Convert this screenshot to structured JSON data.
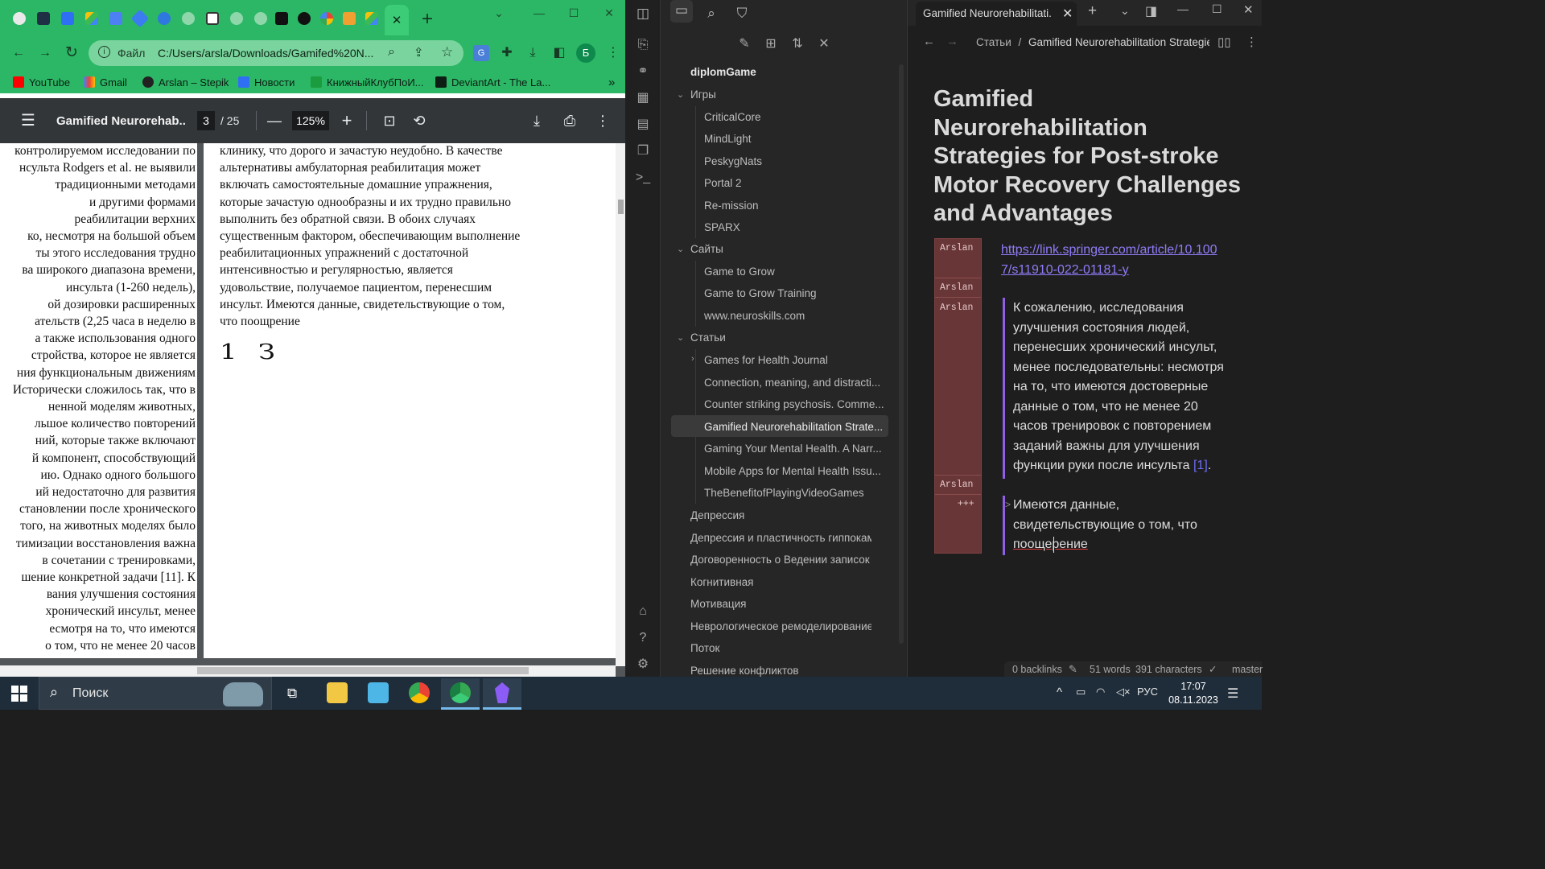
{
  "chrome": {
    "url_prefix": "Файл",
    "url": "C:/Users/arsla/Downloads/Gamifed%20N...",
    "profile_initial": "Б",
    "bookmarks": [
      "YouTube",
      "Gmail",
      "Arslan – Stepik",
      "Новости",
      "КнижныйКлубПоИ...",
      "DeviantArt - The La..."
    ],
    "bookmarks_more": "»",
    "tab_close": "✕",
    "new_tab": "+"
  },
  "pdf": {
    "title": "Gamified Neurorehab...",
    "page_current": "3",
    "page_total": "/ 25",
    "zoom": "125%",
    "left_column": [
      "контролируемом исследовании по",
      "нсульта Rodgers et al. не выявили",
      "традиционными    методами",
      "и          другими    формами",
      "реабилитации       верхних",
      "ко, несмотря на большой объем",
      "ты этого исследования трудно",
      "ва широкого диапазона времени,",
      "инсульта   (1-260   недель),",
      "ой    дозировки    расширенных",
      "ательств (2,25 часа в неделю в",
      "а также использования одного",
      "стройства, которое не является",
      "ния функциональным движениям",
      "Исторически сложилось так, что в",
      "ненной   моделям    животных,",
      "льшое   количество   повторений",
      "ний, которые также включают",
      "й   компонент,   способствующий",
      "ию.  Однако  одного  большого",
      "ий   недостаточно   для   развития",
      "становлении после хронического",
      "того, на животных моделях было",
      "тимизации восстановления важна",
      "в    сочетании    с    тренировками,",
      "шение конкретной задачи [11]. К",
      "вания    улучшения    состояния",
      "хронический   инсульт,    менее",
      "есмотря    на    то,    что    имеются",
      "о   том,   что   не   менее   20   часов"
    ],
    "right_column": [
      "клинику, что дорого и зачастую неудобно. В качестве",
      "альтернативы    амбулаторная    реабилитация    может",
      "включать   самостоятельные   домашние   упражнения,",
      "которые зачастую однообразны и их трудно правильно",
      "выполнить  без  обратной  связи.  В  обоих  случаях",
      "существенным фактором, обеспечивающим выполнение",
      "реабилитационных     упражнений     с     достаточной",
      "интенсивностью      и      регулярностью,      является",
      "удовольствие,   получаемое   пациентом,   перенесшим",
      "инсульт.  Имеются  данные,  свидетельствующие  о  том,",
      "что поощрение"
    ],
    "handwritten": "1 З"
  },
  "obsidian": {
    "vault": "diplomGame",
    "tab_title": "Gamified Neurorehabilitati...",
    "breadcrumb_folder": "Статьи",
    "breadcrumb_sep": "/",
    "breadcrumb_note": "Gamified Neurorehabilitation Strategie",
    "tree": {
      "games_folder": "Игры",
      "games": [
        "CriticalCore",
        "MindLight",
        "PeskygNats",
        "Portal 2",
        "Re-mission",
        "SPARX"
      ],
      "sites_folder": "Сайты",
      "sites": [
        "Game to Grow",
        "Game to Grow Training",
        "www.neuroskills.com"
      ],
      "articles_folder": "Статьи",
      "articles_subfolder": "Games for Health Journal",
      "articles": [
        "Connection, meaning, and distracti...",
        "Counter striking psychosis. Comme...",
        "Gamified Neurorehabilitation Strate...",
        "Gaming Your Mental Health. A Narr...",
        "Mobile Apps for Mental Health Issu...",
        "TheBenefitofPlayingVideoGames"
      ],
      "root_notes": [
        "Депрессия",
        "Депрессия и пластичность гиппокам...",
        "Договоренность о Ведении записок",
        "Когнитивная",
        "Мотивация",
        "Неврологическое ремоделирование",
        "Поток",
        "Решение конфликтов"
      ]
    },
    "note": {
      "title": "Gamified Neurorehabilitation Strategies for Post-stroke Motor Recovery Challenges and Advantages",
      "annotator": "Arslan",
      "annot_more": "+++",
      "link_line1": "https://link.springer.com/article/10.100",
      "link_line2": "7/s11910-022-01181-y",
      "quote1": [
        "К сожалению, исследования",
        "улучшения состояния людей,",
        "перенесших хронический инсульт,",
        "менее последовательны: несмотря",
        "на то, что имеются достоверные",
        "данные о том, что не менее 20",
        "часов тренировок с повторением",
        "заданий важны для улучшения",
        "функции руки после инсульта "
      ],
      "quote1_ref": "[1]",
      "quote1_end": ".",
      "quote2": [
        "Имеются данные,",
        "свидетельствующие о том, что",
        "поощерение"
      ]
    },
    "status": {
      "backlinks": "0 backlinks",
      "words": "51 words",
      "characters": "391 characters",
      "branch": "master"
    }
  },
  "taskbar": {
    "search_label": "Поиск",
    "language": "РУС",
    "time": "17:07",
    "date": "08.11.2023"
  }
}
